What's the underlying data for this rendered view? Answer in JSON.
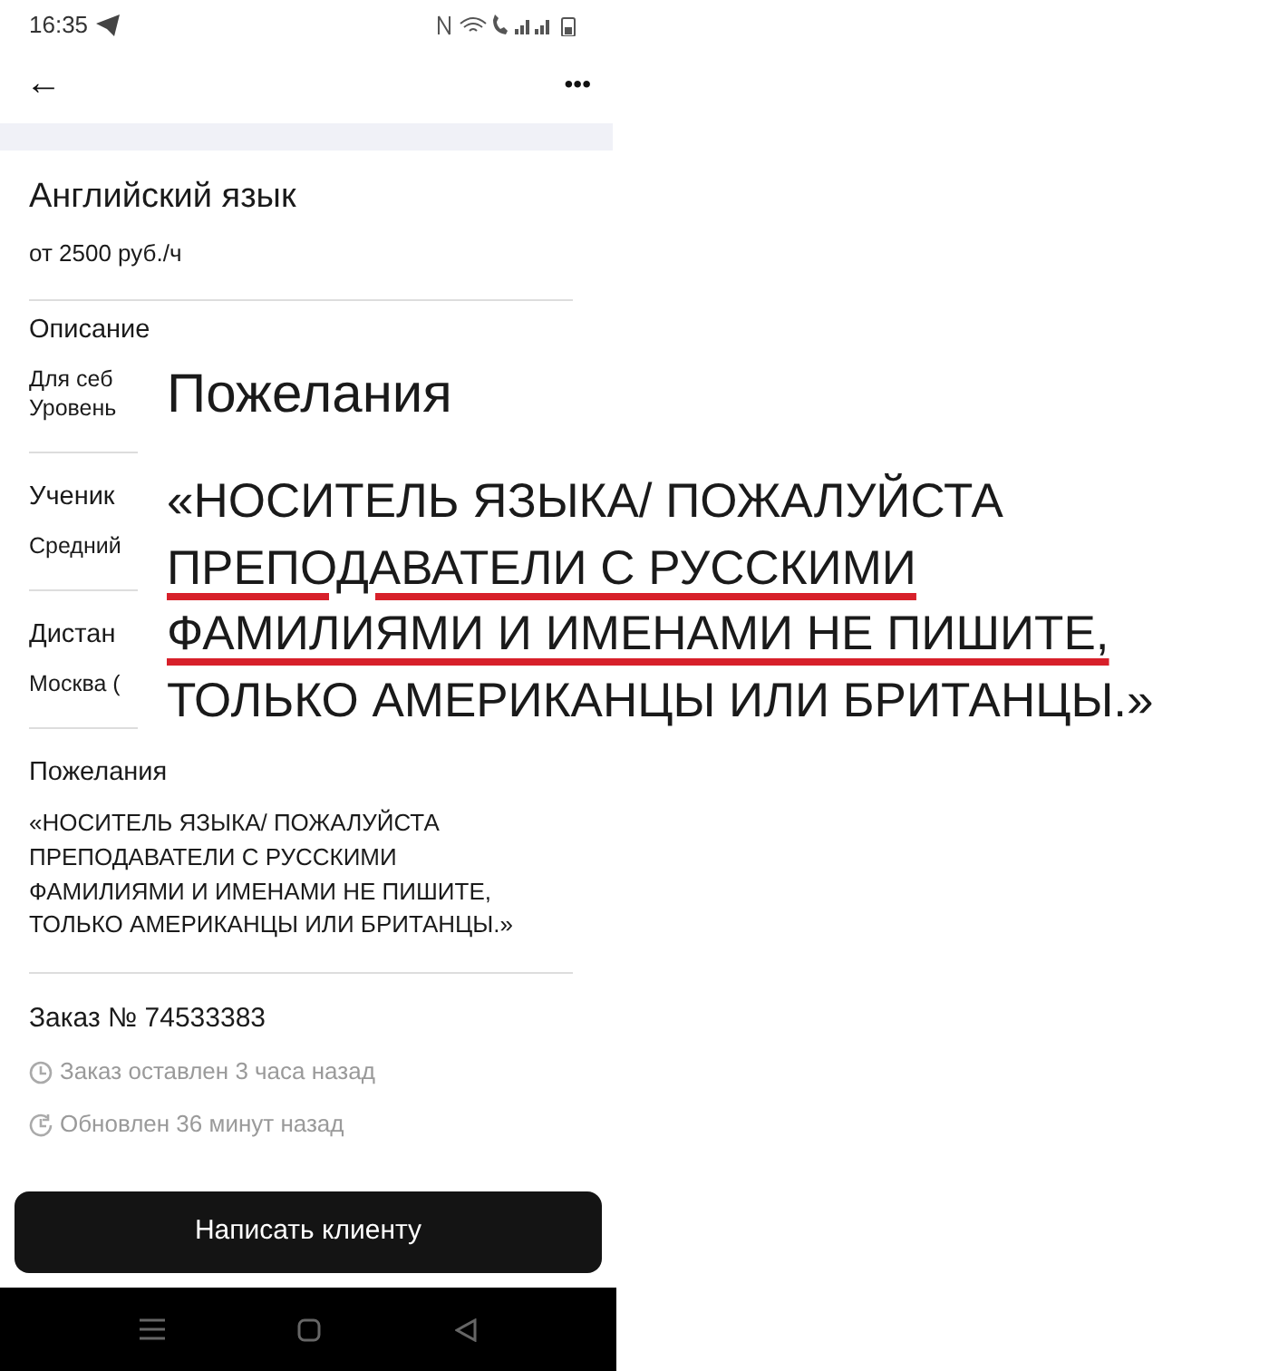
{
  "status_bar": {
    "time": "16:35"
  },
  "header": {
    "back": "←",
    "more": "•••"
  },
  "title": "Английский язык",
  "price": "от 2500 руб./ч",
  "sections": [
    {
      "heading": "Описание",
      "lines": [
        "Для себ",
        "Уровень"
      ]
    },
    {
      "heading": "Ученик",
      "lines": [
        "Средний"
      ]
    },
    {
      "heading": "Дистан",
      "lines": [
        "Москва ("
      ]
    },
    {
      "heading": "Пожелания",
      "lines": [
        "«НОСИТЕЛЬ ЯЗЫКА/ ПОЖАЛУЙСТА ПРЕПОДАВАТЕЛИ С РУССКИМИ ФАМИЛИЯМИ И ИМЕНАМИ НЕ ПИШИТЕ, ТОЛЬКО АМЕРИКАНЦЫ ИЛИ БРИТАНЦЫ.»"
      ]
    }
  ],
  "order": {
    "number": "Заказ № 74533383",
    "meta": [
      {
        "kind": "created",
        "text": "Заказ оставлен 3 часа назад"
      },
      {
        "kind": "updated",
        "text": "Обновлен 36 минут назад"
      }
    ]
  },
  "action_button": "Написать клиенту",
  "zoom_overlay": {
    "heading": "Пожелания",
    "lines": [
      {
        "text": "«НОСИТЕЛЬ ЯЗЫКА/ ПОЖАЛУЙСТА",
        "underlined": false
      },
      {
        "text": "ПРЕПОДАВАТЕЛИ С РУССКИМИ",
        "underlined": true
      },
      {
        "text": "ФАМИЛИЯМИ И ИМЕНАМИ НЕ ПИШИТЕ,",
        "underlined": true
      },
      {
        "text": "ТОЛЬКО АМЕРИКАНЦЫ ИЛИ БРИТАНЦЫ.»",
        "underlined": false
      }
    ]
  }
}
